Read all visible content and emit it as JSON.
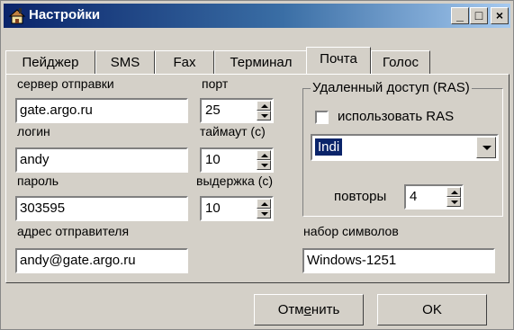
{
  "window": {
    "title": "Настройки",
    "minimize": "_",
    "maximize": "□",
    "close": "×"
  },
  "tabs": [
    {
      "label": "Пейджер"
    },
    {
      "label": "SMS"
    },
    {
      "label": "Fax"
    },
    {
      "label": "Терминал"
    },
    {
      "label": "Почта",
      "active": true
    },
    {
      "label": "Голос"
    }
  ],
  "form": {
    "server_label": "сервер отправки",
    "server_value": "gate.argo.ru",
    "port_label": "порт",
    "port_value": "25",
    "login_label": "логин",
    "login_value": "andy",
    "timeout_label": "таймаут (с)",
    "timeout_value": "10",
    "password_label": "пароль",
    "password_value": "303595",
    "delay_label": "выдержка (с)",
    "delay_value": "10",
    "sender_label": "адрес отправителя",
    "sender_value": "andy@gate.argo.ru",
    "charset_label": "набор символов",
    "charset_value": "Windows-1251"
  },
  "ras": {
    "group_title": "Удаленный доступ (RAS)",
    "use_ras_label": "использовать RAS",
    "use_ras_checked": false,
    "connection_value": "Indi",
    "retries_label": "повторы",
    "retries_value": "4"
  },
  "buttons": {
    "cancel_label_prefix": "Отм",
    "cancel_label_underlined": "е",
    "cancel_label_suffix": "нить",
    "ok_label": "OK"
  },
  "colors": {
    "titlebar_start": "#0a246a",
    "titlebar_end": "#a6caf0",
    "face": "#d4d0c8",
    "selection": "#0a246a"
  }
}
